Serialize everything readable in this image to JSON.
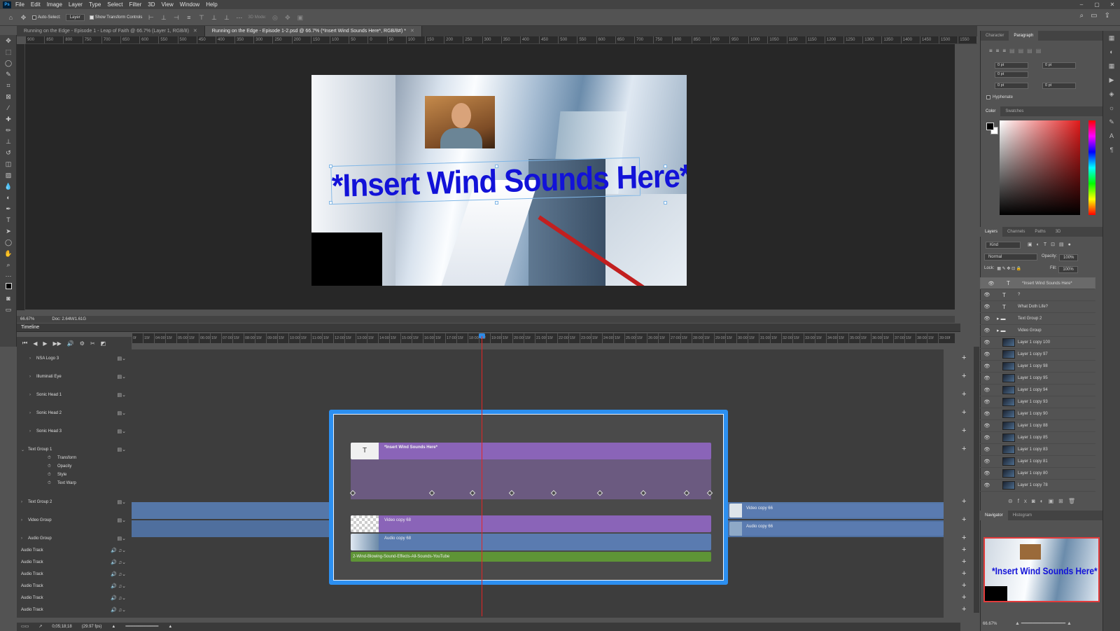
{
  "app": {
    "logo": "Ps",
    "menu": [
      "File",
      "Edit",
      "Image",
      "Layer",
      "Type",
      "Select",
      "Filter",
      "3D",
      "View",
      "Window",
      "Help"
    ]
  },
  "options": {
    "auto_select": "Auto-Select:",
    "layer_select": "Layer",
    "show_transform": "Show Transform Controls",
    "mode3d": "3D Mode:"
  },
  "tabs": [
    {
      "label": "Running on the Edge - Episode 1 - Leap of Faith @ 66.7% (Layer 1, RGB/8)"
    },
    {
      "label": "Running on the Edge - Episode 1-2.psd @ 66.7% (*Insert Wind Sounds Here*, RGB/8#) *"
    }
  ],
  "ruler": [
    "900",
    "850",
    "800",
    "750",
    "700",
    "650",
    "600",
    "550",
    "500",
    "450",
    "400",
    "350",
    "300",
    "250",
    "200",
    "150",
    "100",
    "50",
    "0",
    "50",
    "100",
    "150",
    "200",
    "250",
    "300",
    "350",
    "400",
    "450",
    "500",
    "550",
    "600",
    "650",
    "700",
    "750",
    "800",
    "850",
    "900",
    "950",
    "1000",
    "1050",
    "1100",
    "1150",
    "1200",
    "1250",
    "1300",
    "1350",
    "1400",
    "1450",
    "1500",
    "1550",
    "1600",
    "1650",
    "1700",
    "1750",
    "1800",
    "1850",
    "1900",
    "1950",
    "2000",
    "2050",
    "2100",
    "2150",
    "2200"
  ],
  "canvas": {
    "overlay_text": "*Insert Wind Sounds Here*"
  },
  "status": {
    "zoom": "66.67%",
    "doc": "Doc: 2.64M/1.61G"
  },
  "timeline": {
    "title": "Timeline",
    "ruler": [
      "0f",
      "15f",
      "04:00f",
      "15f",
      "05:00f",
      "15f",
      "06:00f",
      "15f",
      "07:00f",
      "15f",
      "08:00f",
      "15f",
      "09:00f",
      "15f",
      "10:00f",
      "15f",
      "11:00f",
      "15f",
      "12:00f",
      "15f",
      "13:00f",
      "15f",
      "14:00f",
      "15f",
      "15:00f",
      "15f",
      "16:00f",
      "15f",
      "17:00f",
      "15f",
      "18:00f",
      "15f",
      "19:00f",
      "15f",
      "20:00f",
      "15f",
      "21:00f",
      "15f",
      "22:00f",
      "15f",
      "23:00f",
      "15f",
      "24:00f",
      "15f",
      "25:00f",
      "15f",
      "26:00f",
      "15f",
      "27:00f",
      "15f",
      "28:00f",
      "15f",
      "29:00f",
      "15f",
      "30:00f",
      "15f",
      "31:00f",
      "15f",
      "32:00f",
      "15f",
      "33:00f",
      "15f",
      "34:00f",
      "15f",
      "35:00f",
      "15f",
      "36:00f",
      "15f",
      "37:00f",
      "15f",
      "38:00f",
      "15f",
      "39:00f"
    ],
    "tracks": [
      "NSA Logo 3",
      "Illuminati Eye",
      "Sonic Head 1",
      "Sonic Head 2",
      "Sonic Head 3",
      "Text Group 1",
      "Transform",
      "Opacity",
      "Style",
      "Text Warp",
      "Text Group 2",
      "Video Group",
      "Audio Group",
      "Audio Track",
      "Audio Track",
      "Audio Track",
      "Audio Track",
      "Audio Track",
      "Audio Track"
    ],
    "clips": {
      "text": "*Insert Wind Sounds Here*",
      "video": "Video copy 68",
      "audio": "Audio copy 68",
      "wind": "2-Wind-Blowing-Sound-Effects-All-Sounds-YouTube",
      "video2": "Video copy 66",
      "audio2": "Audio copy 66"
    },
    "timecode": "0;05;18;18",
    "fps": "(29.97 fps)"
  },
  "panels": {
    "char_tabs": [
      "Character",
      "Paragraph"
    ],
    "para_vals": [
      "0 pt",
      "0 pt",
      "0 pt",
      "0 pt",
      "0 pt"
    ],
    "hyphenate": "Hyphenate",
    "color_tabs": [
      "Color",
      "Swatches"
    ],
    "layer_tabs": [
      "Layers",
      "Channels",
      "Paths",
      "3D"
    ],
    "kind": "Kind",
    "blend": "Normal",
    "opacity_label": "Opacity:",
    "opacity": "100%",
    "lock_label": "Lock:",
    "fill_label": "Fill:",
    "fill": "100%",
    "layers": [
      "*Insert Wind Sounds Here*",
      "?",
      "What Doth Life?",
      "Text Group 2",
      "Video Group",
      "Layer 1 copy 100",
      "Layer 1 copy 97",
      "Layer 1 copy 98",
      "Layer 1 copy 95",
      "Layer 1 copy 94",
      "Layer 1 copy 93",
      "Layer 1 copy 90",
      "Layer 1 copy 88",
      "Layer 1 copy 85",
      "Layer 1 copy 83",
      "Layer 1 copy 81",
      "Layer 1 copy 80",
      "Layer 1 copy 78"
    ],
    "nav_tabs": [
      "Navigator",
      "Histogram"
    ],
    "nav_zoom": "66.67%",
    "nav_text": "*Insert Wind Sounds Here*"
  },
  "colors": {
    "accent": "#2c8ff0",
    "text_blue": "#1212d8",
    "clip_purple": "#8a64b8",
    "clip_blue": "#5a7bb0",
    "clip_green": "#5e9436",
    "playhead": "#e42424"
  }
}
